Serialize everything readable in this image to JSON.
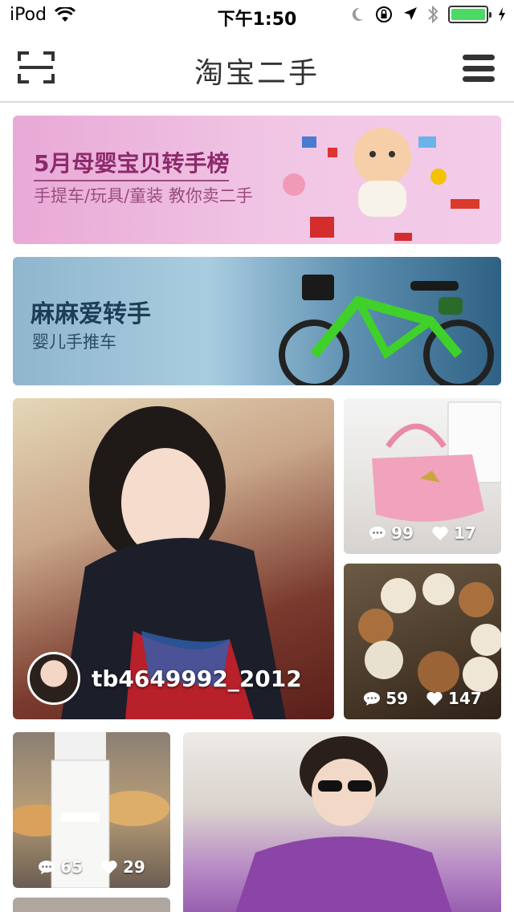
{
  "status_bar": {
    "carrier": "iPod",
    "time": "下午1:50",
    "battery_level": 1.0,
    "icons": [
      "wifi-icon",
      "moon-icon",
      "rotation-lock-icon",
      "location-icon",
      "bluetooth-icon",
      "battery-icon",
      "charging-icon"
    ]
  },
  "nav": {
    "title": "淘宝二手",
    "left_icon": "scan-icon",
    "right_icon": "menu-icon"
  },
  "banners": [
    {
      "title": "5月母婴宝贝转手榜",
      "subtitle": "手提车/玩具/童装 教你卖二手"
    },
    {
      "title": "麻麻爱转手",
      "subtitle": "婴儿手推车"
    }
  ],
  "feed": {
    "big_card": {
      "username": "tb4649992_2012"
    },
    "cards": [
      {
        "comments": "99",
        "likes": "17"
      },
      {
        "comments": "59",
        "likes": "147"
      },
      {
        "comments": "65",
        "likes": "29"
      }
    ]
  },
  "colors": {
    "status_battery": "#4cd964",
    "divider": "#d9d9d9",
    "banner1_title": "#8c2a6b",
    "banner2_title": "#1e3e55"
  }
}
